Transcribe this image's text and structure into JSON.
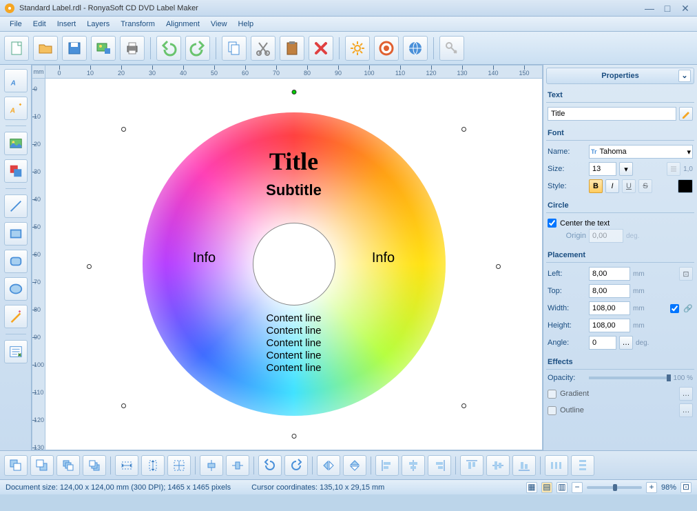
{
  "window": {
    "title": "Standard Label.rdl - RonyaSoft CD DVD Label Maker"
  },
  "menu": [
    "File",
    "Edit",
    "Insert",
    "Layers",
    "Transform",
    "Alignment",
    "View",
    "Help"
  ],
  "ruler_unit": "mm",
  "ruler_ticks": [
    "0",
    "10",
    "20",
    "30",
    "40",
    "50",
    "60",
    "70",
    "80",
    "90",
    "100",
    "110",
    "120",
    "130",
    "140",
    "150"
  ],
  "ruler_ticks_v": [
    "0",
    "10",
    "20",
    "30",
    "40",
    "50",
    "60",
    "70",
    "80",
    "90",
    "100",
    "110",
    "120",
    "130"
  ],
  "disc": {
    "title": "Title",
    "subtitle": "Subtitle",
    "info_left": "Info",
    "info_right": "Info",
    "content": "Content line\nContent line\nContent line\nContent line\nContent line"
  },
  "props": {
    "panel_title": "Properties",
    "text_label": "Text",
    "text_value": "Title",
    "font_label": "Font",
    "font_name_label": "Name:",
    "font_name_value": "Tahoma",
    "font_size_label": "Size:",
    "font_size_value": "13",
    "line_spacing": "1,0",
    "font_style_label": "Style:",
    "circle_label": "Circle",
    "center_text_label": "Center the text",
    "center_checked": true,
    "origin_label": "Origin",
    "origin_value": "0,00",
    "origin_unit": "deg.",
    "placement_label": "Placement",
    "left_label": "Left:",
    "left_value": "8,00",
    "top_label": "Top:",
    "top_value": "8,00",
    "width_label": "Width:",
    "width_value": "108,00",
    "height_label": "Height:",
    "height_value": "108,00",
    "angle_label": "Angle:",
    "angle_value": "0",
    "mm_unit": "mm",
    "deg_unit": "deg.",
    "effects_label": "Effects",
    "opacity_label": "Opacity:",
    "opacity_value": "100 %",
    "gradient_label": "Gradient",
    "outline_label": "Outline"
  },
  "status": {
    "doc": "Document size: 124,00 x 124,00 mm (300 DPI); 1465 x 1465 pixels",
    "cursor": "Cursor coordinates: 135,10 x 29,15 mm",
    "zoom": "98%"
  }
}
